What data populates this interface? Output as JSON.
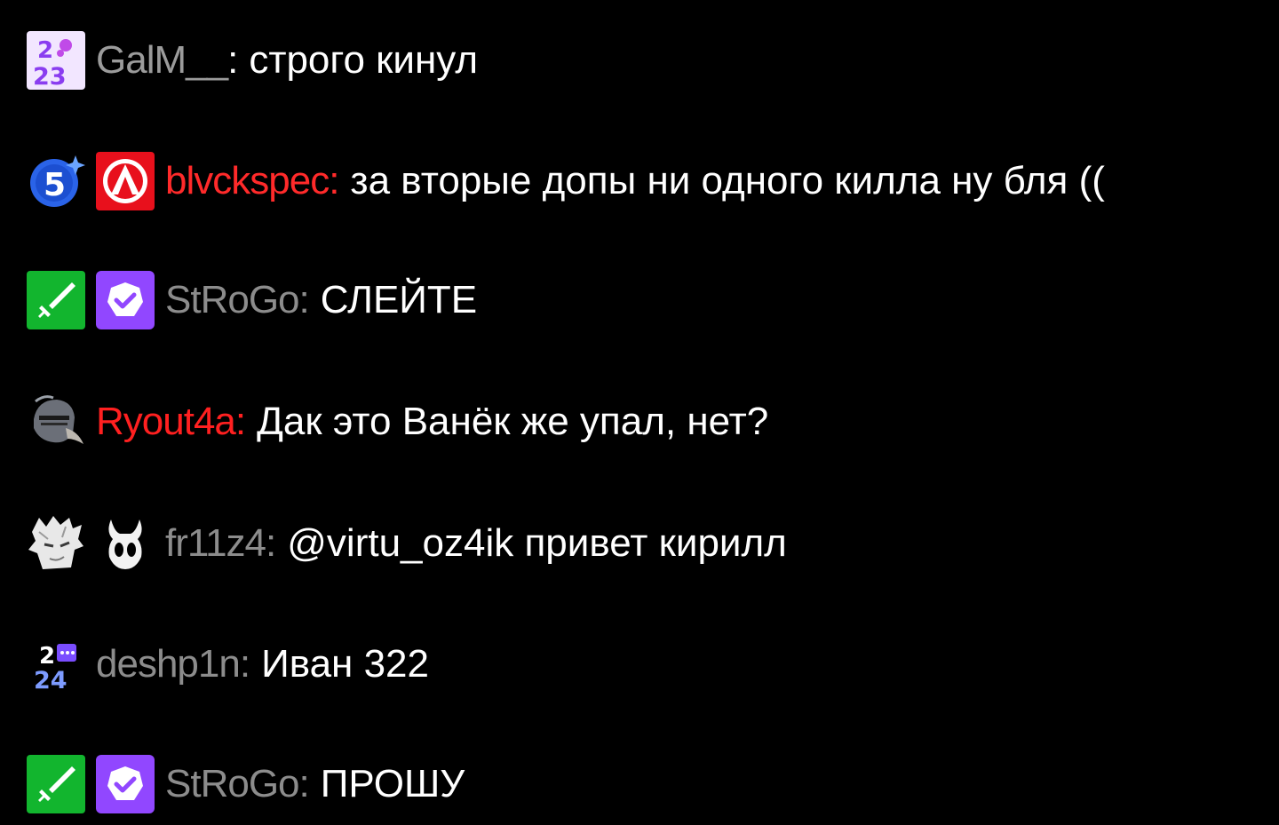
{
  "messages": [
    {
      "author": "GalM__",
      "color": "#9b9b9b",
      "text": "строго кинул",
      "badges": [
        {
          "name": "year-2023-badge-icon",
          "top": "2",
          "bottom": "23"
        }
      ]
    },
    {
      "author": "blvckspec",
      "color": "#ff2a2a",
      "text": "за вторые допы ни одного килла ну бля ((",
      "badges": [
        {
          "name": "subscriber-5-badge-icon",
          "label": "5"
        },
        {
          "name": "game-logo-badge-icon"
        }
      ]
    },
    {
      "author": "StRoGo",
      "color": "#8c8c8c",
      "text": "СЛЕЙТЕ",
      "badges": [
        {
          "name": "moderator-sword-badge-icon"
        },
        {
          "name": "verified-badge-icon"
        }
      ]
    },
    {
      "author": "Ryout4a",
      "color": "#ff2020",
      "text": "Дак это Ванёк же упал, нет?",
      "badges": [
        {
          "name": "knight-helmet-badge-icon"
        }
      ]
    },
    {
      "author": "fr11z4",
      "color": "#8c8c8c",
      "text": "@virtu_oz4ik привет кирилл",
      "badges": [
        {
          "name": "anime-avatar-badge-icon"
        },
        {
          "name": "hollow-knight-badge-icon"
        }
      ]
    },
    {
      "author": "deshp1n",
      "color": "#8c8c8c",
      "text": "Иван 322",
      "badges": [
        {
          "name": "year-2024-badge-icon",
          "top": "2",
          "bottom": "24"
        }
      ]
    },
    {
      "author": "StRoGo",
      "color": "#8c8c8c",
      "text": "ПРОШУ",
      "badges": [
        {
          "name": "moderator-sword-badge-icon"
        },
        {
          "name": "verified-badge-icon"
        }
      ]
    }
  ],
  "separator": ":"
}
